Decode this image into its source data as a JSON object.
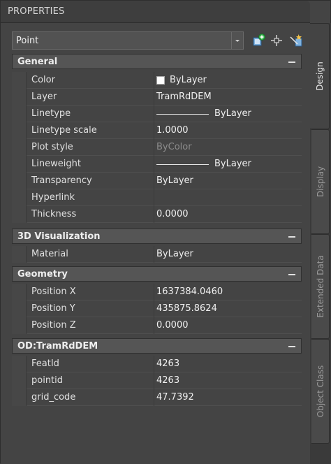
{
  "palette": {
    "title": "PROPERTIES"
  },
  "selector": {
    "value": "Point"
  },
  "toolbar": {
    "icons": [
      "select-objects-icon",
      "pickadd-icon",
      "quick-select-icon"
    ]
  },
  "sections": {
    "general": {
      "title": "General",
      "rows": [
        {
          "name": "Color",
          "value": "ByLayer",
          "swatch": "#ffffff"
        },
        {
          "name": "Layer",
          "value": "TramRdDEM"
        },
        {
          "name": "Linetype",
          "value": "ByLayer"
        },
        {
          "name": "Linetype scale",
          "value": "1.0000"
        },
        {
          "name": "Plot style",
          "value": "ByColor"
        },
        {
          "name": "Lineweight",
          "value": "ByLayer"
        },
        {
          "name": "Transparency",
          "value": "ByLayer"
        },
        {
          "name": "Hyperlink",
          "value": ""
        },
        {
          "name": "Thickness",
          "value": "0.0000"
        }
      ]
    },
    "visualization": {
      "title": "3D Visualization",
      "rows": [
        {
          "name": "Material",
          "value": "ByLayer"
        }
      ]
    },
    "geometry": {
      "title": "Geometry",
      "rows": [
        {
          "name": "Position X",
          "value": "1637384.0460"
        },
        {
          "name": "Position Y",
          "value": "435875.8624"
        },
        {
          "name": "Position Z",
          "value": "0.0000"
        }
      ]
    },
    "od": {
      "title": "OD:TramRdDEM",
      "rows": [
        {
          "name": "FeatId",
          "value": "4263"
        },
        {
          "name": "pointid",
          "value": "4263"
        },
        {
          "name": "grid_code",
          "value": "47.7392"
        }
      ]
    }
  },
  "tabs": [
    {
      "label": "Design",
      "active": true
    },
    {
      "label": "Display",
      "active": false
    },
    {
      "label": "Extended Data",
      "active": false
    },
    {
      "label": "Object Class",
      "active": false
    }
  ]
}
